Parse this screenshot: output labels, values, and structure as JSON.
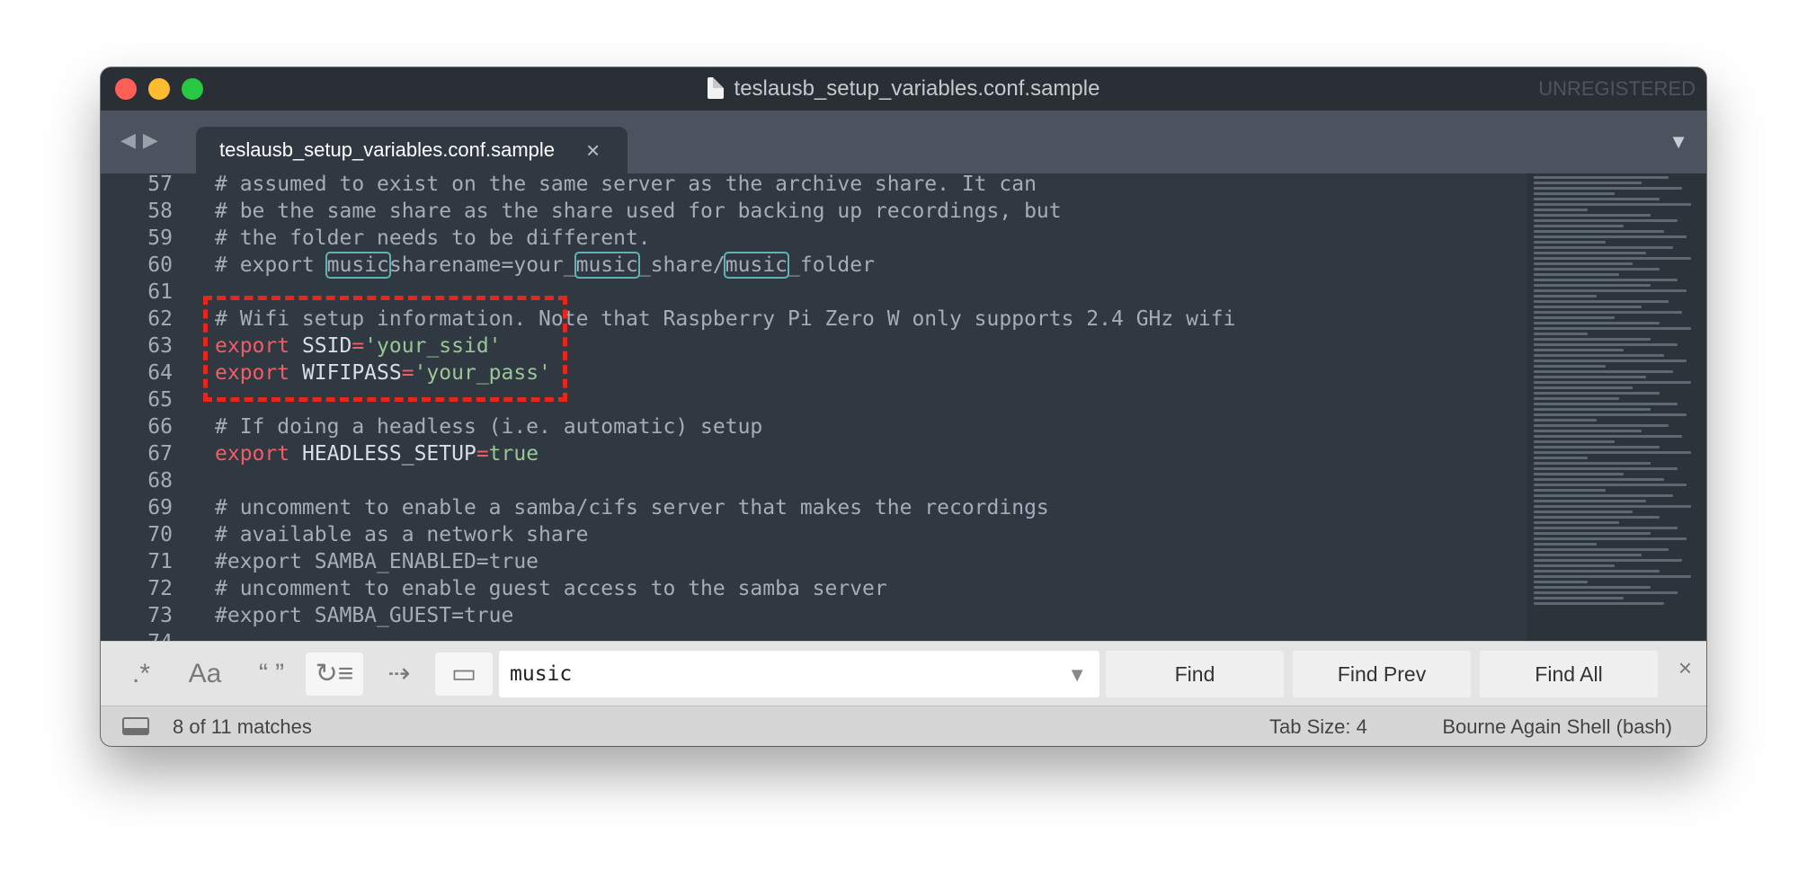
{
  "window": {
    "title": "teslausb_setup_variables.conf.sample",
    "unregistered": "UNREGISTERED"
  },
  "tabs": [
    {
      "label": "teslausb_setup_variables.conf.sample",
      "close": "×"
    }
  ],
  "navigation": {
    "back": "◀",
    "forward": "▶",
    "tab_menu": "▼"
  },
  "editor": {
    "lines": [
      {
        "num": "57",
        "text": "# assumed to exist on the same server as the archive share. It can"
      },
      {
        "num": "58",
        "text": "# be the same share as the share used for backing up recordings, but"
      },
      {
        "num": "59",
        "text": "# the folder needs to be different."
      },
      {
        "num": "60",
        "text": "# export musicsharename=your_music_share/music_folder"
      },
      {
        "num": "61",
        "text": ""
      },
      {
        "num": "62",
        "text": "# Wifi setup information. Note that Raspberry Pi Zero W only supports 2.4 GHz wifi"
      },
      {
        "num": "63",
        "text": "export SSID='your_ssid'"
      },
      {
        "num": "64",
        "text": "export WIFIPASS='your_pass'"
      },
      {
        "num": "65",
        "text": ""
      },
      {
        "num": "66",
        "text": "# If doing a headless (i.e. automatic) setup"
      },
      {
        "num": "67",
        "text": "export HEADLESS_SETUP=true"
      },
      {
        "num": "68",
        "text": ""
      },
      {
        "num": "69",
        "text": "# uncomment to enable a samba/cifs server that makes the recordings"
      },
      {
        "num": "70",
        "text": "# available as a network share"
      },
      {
        "num": "71",
        "text": "#export SAMBA_ENABLED=true"
      },
      {
        "num": "72",
        "text": "# uncomment to enable guest access to the samba server"
      },
      {
        "num": "73",
        "text": "#export SAMBA_GUEST=true"
      },
      {
        "num": "74",
        "text": ""
      }
    ],
    "tokens": {
      "l60": [
        "# export ",
        "music",
        "sharename=your_",
        "music",
        "_share/",
        "music",
        "_folder"
      ],
      "l63": [
        "export",
        " SSID",
        "=",
        "'your_ssid'"
      ],
      "l64": [
        "export",
        " WIFIPASS",
        "=",
        "'your_pass'"
      ],
      "l67": [
        "export",
        " HEADLESS_SETUP",
        "=",
        "true"
      ]
    }
  },
  "find_bar": {
    "options": [
      {
        "label": ".*",
        "name": "regex-option"
      },
      {
        "label": "Aa",
        "name": "case-sensitive-option"
      },
      {
        "label": "“ ”",
        "name": "whole-word-option"
      },
      {
        "label": "↻≡",
        "name": "wrap-option"
      },
      {
        "label": "⇢",
        "name": "in-selection-option"
      },
      {
        "label": "▭",
        "name": "highlight-matches-option"
      }
    ],
    "query": "music",
    "buttons": {
      "find": "Find",
      "find_prev": "Find Prev",
      "find_all": "Find All"
    },
    "close": "×"
  },
  "status_bar": {
    "matches": "8 of 11 matches",
    "tab_size": "Tab Size: 4",
    "syntax": "Bourne Again Shell (bash)"
  },
  "colors": {
    "editor_bg": "#303841",
    "keyword": "#ec5f67",
    "string": "#99c794",
    "comment": "#a6acb8",
    "match_outline": "#5fb3b3",
    "annotation_box": "#e8261c"
  }
}
